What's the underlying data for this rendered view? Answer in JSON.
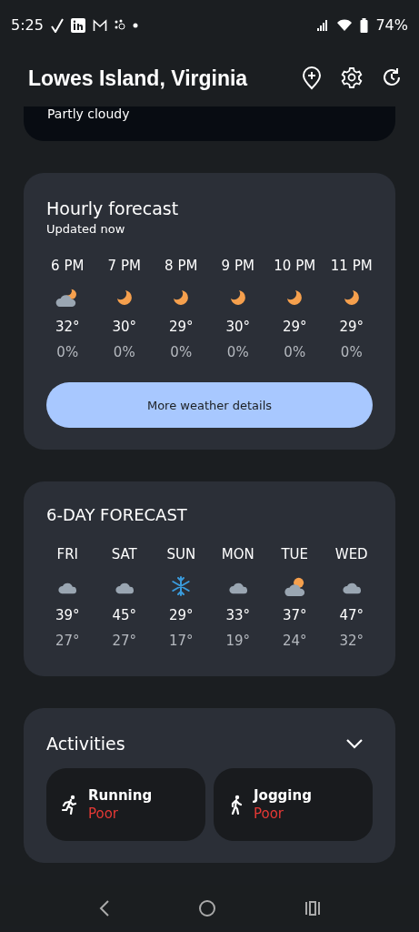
{
  "status_bar": {
    "time": "5:25",
    "battery": "74%"
  },
  "header": {
    "title": "Lowes Island, Virginia"
  },
  "current": {
    "condition": "Partly cloudy"
  },
  "hourly": {
    "title": "Hourly forecast",
    "subtitle": "Updated now",
    "button": "More weather details",
    "hours": [
      {
        "time": "6 PM",
        "kind": "partly-cloudy-night",
        "temp": "32°",
        "precip": "0%"
      },
      {
        "time": "7 PM",
        "kind": "moon",
        "temp": "30°",
        "precip": "0%"
      },
      {
        "time": "8 PM",
        "kind": "moon",
        "temp": "29°",
        "precip": "0%"
      },
      {
        "time": "9 PM",
        "kind": "moon",
        "temp": "30°",
        "precip": "0%"
      },
      {
        "time": "10 PM",
        "kind": "moon",
        "temp": "29°",
        "precip": "0%"
      },
      {
        "time": "11 PM",
        "kind": "moon",
        "temp": "29°",
        "precip": "0%"
      }
    ]
  },
  "daily": {
    "title": "6-DAY FORECAST",
    "days": [
      {
        "day": "FRI",
        "kind": "cloud",
        "high": "39°",
        "low": "27°"
      },
      {
        "day": "SAT",
        "kind": "cloud",
        "high": "45°",
        "low": "27°"
      },
      {
        "day": "SUN",
        "kind": "snow",
        "high": "29°",
        "low": "17°"
      },
      {
        "day": "MON",
        "kind": "cloud",
        "high": "33°",
        "low": "19°"
      },
      {
        "day": "TUE",
        "kind": "partly-cloudy",
        "high": "37°",
        "low": "24°"
      },
      {
        "day": "WED",
        "kind": "cloud",
        "high": "47°",
        "low": "32°"
      }
    ]
  },
  "activities": {
    "title": "Activities",
    "expanded": false,
    "items": [
      {
        "name": "Running",
        "kind": "running",
        "rating": "Poor",
        "color": "#e53935"
      },
      {
        "name": "Jogging",
        "kind": "walking",
        "rating": "Poor",
        "color": "#e53935"
      }
    ]
  }
}
